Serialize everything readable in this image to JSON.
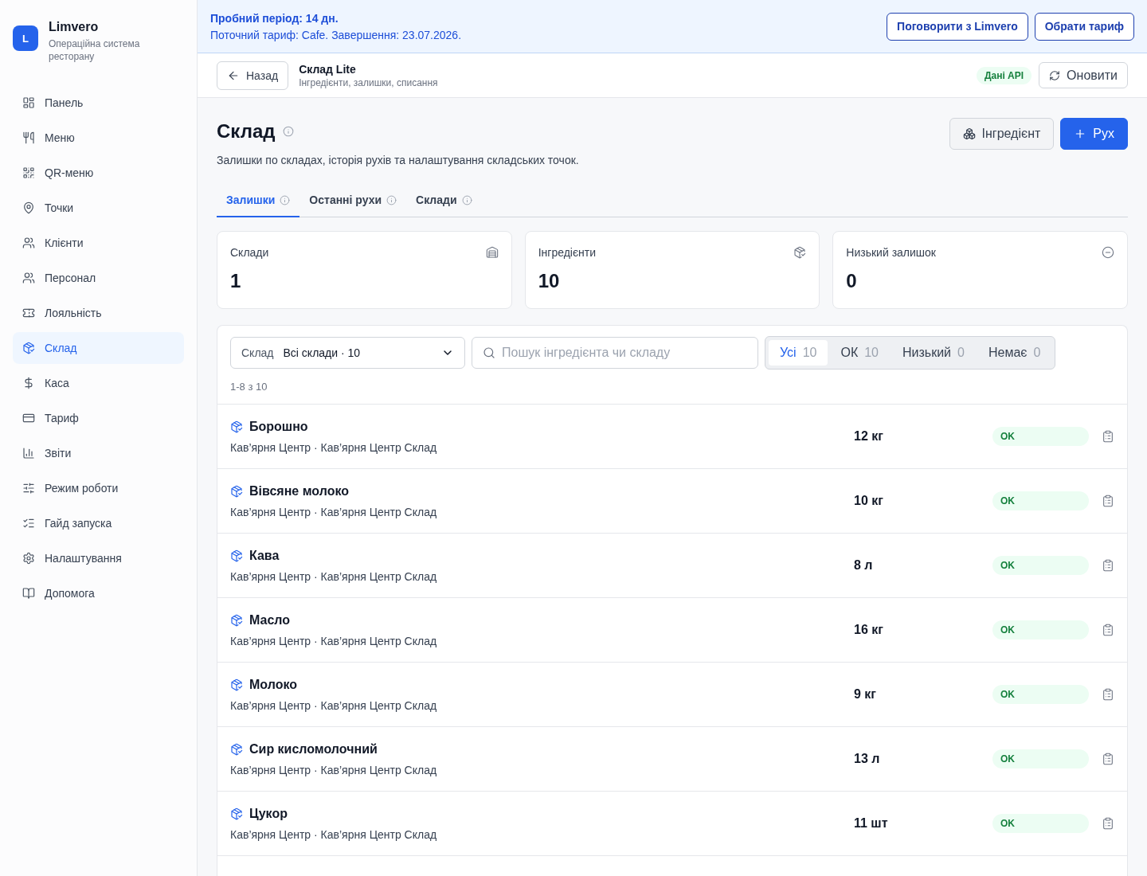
{
  "sidebar": {
    "brand": {
      "logo_letter": "L",
      "name": "Limvero",
      "tagline": "Операційна система ресторану"
    },
    "items": [
      {
        "label": "Панель",
        "selected": false
      },
      {
        "label": "Меню",
        "selected": false
      },
      {
        "label": "QR-меню",
        "selected": false
      },
      {
        "label": "Точки",
        "selected": false
      },
      {
        "label": "Клієнти",
        "selected": false
      },
      {
        "label": "Персонал",
        "selected": false
      },
      {
        "label": "Лояльність",
        "selected": false
      },
      {
        "label": "Склад",
        "selected": true
      },
      {
        "label": "Каса",
        "selected": false
      },
      {
        "label": "Тариф",
        "selected": false
      },
      {
        "label": "Звіти",
        "selected": false
      },
      {
        "label": "Режим роботи",
        "selected": false
      },
      {
        "label": "Гайд запуска",
        "selected": false
      },
      {
        "label": "Налаштування",
        "selected": false
      },
      {
        "label": "Допомога",
        "selected": false
      }
    ]
  },
  "trial_banner": {
    "title": "Пробний період: 14 дн.",
    "details": "Поточний тариф: Cafe. Завершення: 23.07.2026.",
    "buttons": [
      "Поговорити з Limvero",
      "Обрати тариф"
    ]
  },
  "header": {
    "back_button": "Назад",
    "title": "Склад Lite",
    "subtitle": "Інгредієнти, залишки, списання",
    "source_badge": "Дані API",
    "refresh_button": "Оновити"
  },
  "page": {
    "title": "Склад",
    "description": "Залишки по складах, історія рухів та налаштування складських точок.",
    "buttons": [
      {
        "label": "Інгредієнт",
        "kind": "secondary"
      },
      {
        "label": "Рух",
        "kind": "primary"
      }
    ]
  },
  "tabs": [
    {
      "label": "Залишки",
      "selected": true
    },
    {
      "label": "Останні рухи",
      "selected": false
    },
    {
      "label": "Склади",
      "selected": false
    }
  ],
  "stats": [
    {
      "label": "Склади",
      "value": "1"
    },
    {
      "label": "Інгредієнти",
      "value": "10"
    },
    {
      "label": "Низький залишок",
      "value": "0"
    }
  ],
  "filters": {
    "warehouse_select": {
      "label": "Склад",
      "value": "Всі склади · 10"
    },
    "search": {
      "placeholder": "Пошук інгредієнта чи складу"
    },
    "status_filter": [
      {
        "label": "Усі",
        "count": "10",
        "selected": true
      },
      {
        "label": "ОК",
        "count": "10",
        "selected": false
      },
      {
        "label": "Низький",
        "count": "0",
        "selected": false
      },
      {
        "label": "Немає",
        "count": "0",
        "selected": false
      }
    ]
  },
  "range": "1-8 з 10",
  "rows": [
    {
      "name": "Борошно",
      "location": "Кав’ярня Центр · Кав’ярня Центр Склад",
      "quantity": "12 кг",
      "status": "OK"
    },
    {
      "name": "Вівсяне молоко",
      "location": "Кав’ярня Центр · Кав’ярня Центр Склад",
      "quantity": "10 кг",
      "status": "OK"
    },
    {
      "name": "Кава",
      "location": "Кав’ярня Центр · Кав’ярня Центр Склад",
      "quantity": "8 л",
      "status": "OK"
    },
    {
      "name": "Масло",
      "location": "Кав’ярня Центр · Кав’ярня Центр Склад",
      "quantity": "16 кг",
      "status": "OK"
    },
    {
      "name": "Молоко",
      "location": "Кав’ярня Центр · Кав’ярня Центр Склад",
      "quantity": "9 кг",
      "status": "OK"
    },
    {
      "name": "Сир кисломолочний",
      "location": "Кав’ярня Центр · Кав’ярня Центр Склад",
      "quantity": "13 л",
      "status": "OK"
    },
    {
      "name": "Цукор",
      "location": "Кав’ярня Центр · Кав’ярня Центр Склад",
      "quantity": "11 шт",
      "status": "OK"
    }
  ]
}
